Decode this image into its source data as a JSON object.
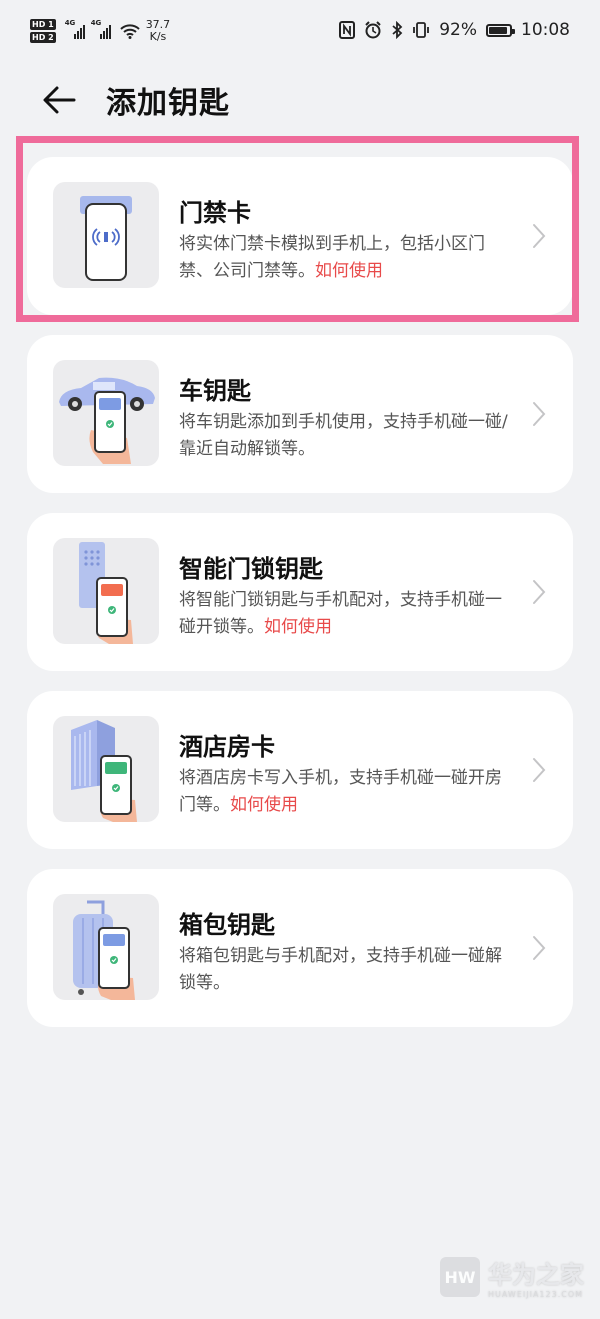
{
  "status_bar": {
    "hd1": "HD 1",
    "hd2": "HD 2",
    "net1": "4G",
    "net2": "4G",
    "speed_value": "37.7",
    "speed_unit": "K/s",
    "battery": "92%",
    "time": "10:08"
  },
  "header": {
    "title": "添加钥匙"
  },
  "cards": [
    {
      "name": "门禁卡",
      "desc": "将实体门禁卡模拟到手机上，包括小区门禁、公司门禁等。",
      "link": "如何使用"
    },
    {
      "name": "车钥匙",
      "desc": "将车钥匙添加到手机使用，支持手机碰一碰/靠近自动解锁等。",
      "link": ""
    },
    {
      "name": "智能门锁钥匙",
      "desc": "将智能门锁钥匙与手机配对，支持手机碰一碰开锁等。",
      "link": "如何使用"
    },
    {
      "name": "酒店房卡",
      "desc": "将酒店房卡写入手机，支持手机碰一碰开房门等。",
      "link": "如何使用"
    },
    {
      "name": "箱包钥匙",
      "desc": "将箱包钥匙与手机配对，支持手机碰一碰解锁等。",
      "link": ""
    }
  ],
  "watermark": {
    "logo": "HW",
    "name": "华为之家",
    "url": "HUAWEIJIA123.COM"
  },
  "colors": {
    "background": "#f1f2f4",
    "card": "#ffffff",
    "link": "#e84a4a",
    "highlight": "#ef6b9a"
  }
}
